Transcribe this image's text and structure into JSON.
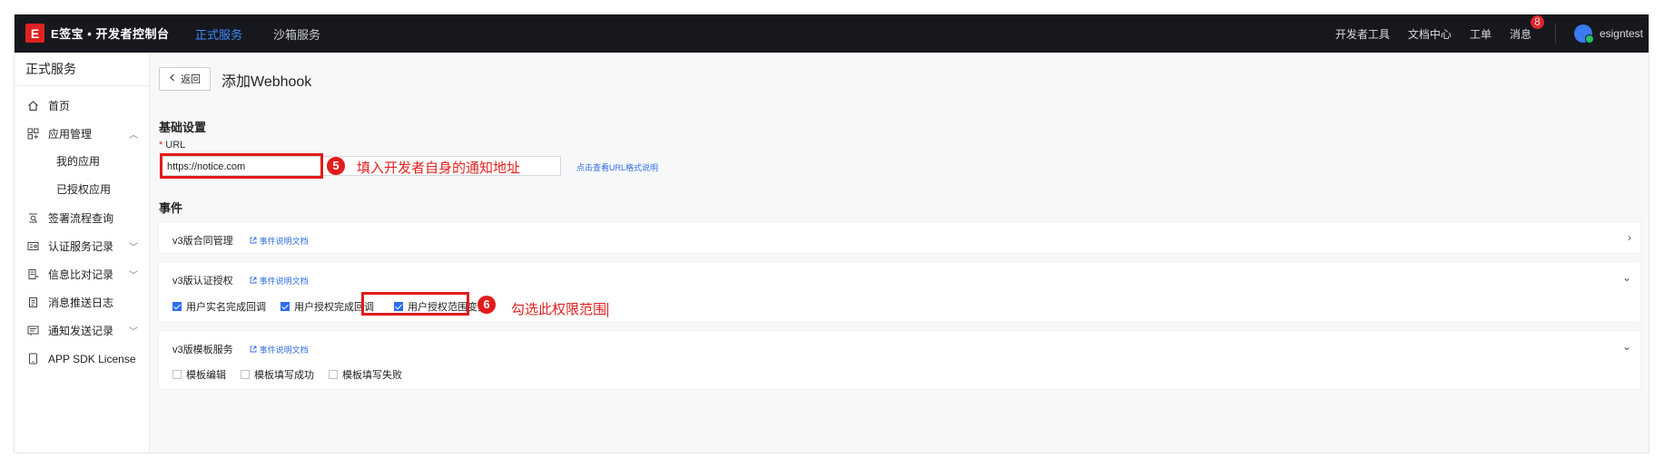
{
  "topbar": {
    "logo_mark": "E",
    "logo_text": "E签宝 • 开发者控制台",
    "nav": [
      {
        "label": "正式服务",
        "active": true
      },
      {
        "label": "沙箱服务",
        "active": false
      }
    ],
    "right_links": [
      "开发者工具",
      "文档中心",
      "工单"
    ],
    "messages_label": "消息",
    "messages_count": "8",
    "username": "esigntest"
  },
  "sidebar": {
    "title": "正式服务",
    "items": [
      {
        "label": "首页",
        "icon": "home-icon"
      },
      {
        "label": "应用管理",
        "icon": "apps-icon",
        "expanded": true
      },
      {
        "label": "我的应用",
        "sub": true
      },
      {
        "label": "已授权应用",
        "sub": true
      },
      {
        "label": "签署流程查询",
        "icon": "search-doc-icon"
      },
      {
        "label": "认证服务记录",
        "icon": "id-card-icon",
        "expandable": true
      },
      {
        "label": "信息比对记录",
        "icon": "compare-icon",
        "expandable": true
      },
      {
        "label": "消息推送日志",
        "icon": "log-icon"
      },
      {
        "label": "通知发送记录",
        "icon": "notice-icon",
        "expandable": true
      },
      {
        "label": "APP SDK License",
        "icon": "tablet-icon"
      }
    ]
  },
  "main": {
    "back_label": "返回",
    "page_title": "添加Webhook",
    "basic_title": "基础设置",
    "url_label": "URL",
    "url_value": "https://notice.com",
    "url_help": "点击查看URL格式说明",
    "events_title": "事件",
    "doc_link": "事件说明文档",
    "groups": [
      {
        "name": "v3版合同管理",
        "expanded": false,
        "events": []
      },
      {
        "name": "v3版认证授权",
        "expanded": true,
        "events": [
          {
            "label": "用户实名完成回调",
            "checked": true
          },
          {
            "label": "用户授权完成回调",
            "checked": true
          },
          {
            "label": "用户授权范围变更",
            "checked": true
          }
        ]
      },
      {
        "name": "v3版模板服务",
        "expanded": true,
        "events": [
          {
            "label": "模板编辑",
            "checked": false
          },
          {
            "label": "模板填写成功",
            "checked": false
          },
          {
            "label": "模板填写失败",
            "checked": false
          }
        ]
      }
    ]
  },
  "annotations": [
    {
      "step": "5",
      "text": "填入开发者自身的通知地址"
    },
    {
      "step": "6",
      "text": "勾选此权限范围"
    }
  ],
  "colors": {
    "accent": "#2d6cf0",
    "highlight": "#e21b1b",
    "topbar": "#16181d"
  }
}
